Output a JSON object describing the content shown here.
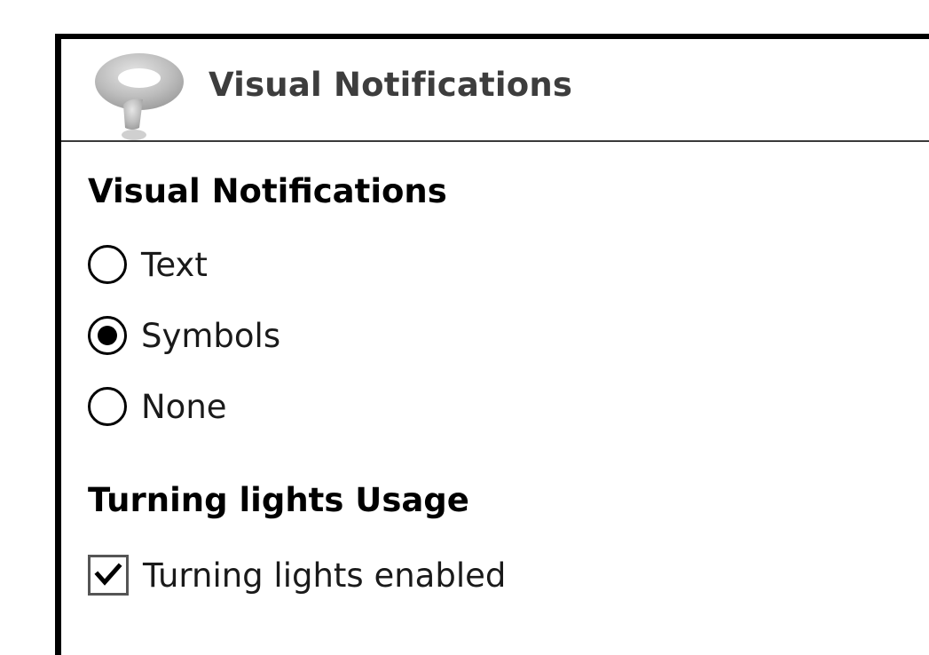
{
  "window": {
    "title": "Visual Notifications",
    "icon": "question-mark-icon"
  },
  "visual_notifications": {
    "heading": "Visual Notifications",
    "options": [
      {
        "label": "Text",
        "selected": false
      },
      {
        "label": "Symbols",
        "selected": true
      },
      {
        "label": "None",
        "selected": false
      }
    ]
  },
  "turning_lights": {
    "heading": "Turning lights Usage",
    "checkbox_label": "Turning lights enabled",
    "checked": true
  },
  "colors": {
    "border": "#000000",
    "title_text": "#3d3d3d",
    "icon_gray": "#b8b8b8"
  }
}
